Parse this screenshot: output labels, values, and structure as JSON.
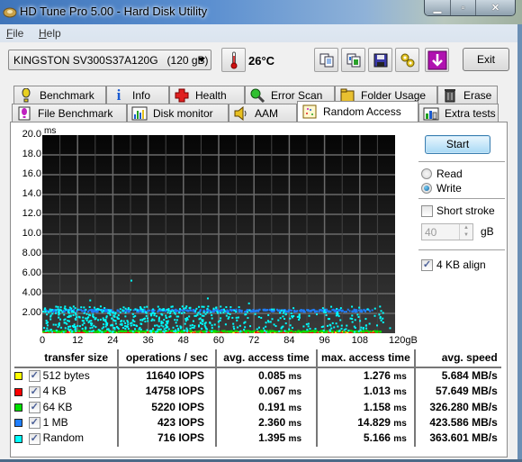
{
  "window": {
    "title": "HD Tune Pro 5.00 - Hard Disk Utility",
    "controls": [
      "minimize",
      "maximize",
      "close"
    ]
  },
  "menu": [
    {
      "label": "File",
      "accel": "F"
    },
    {
      "label": "Help",
      "accel": "H"
    }
  ],
  "toolbar": {
    "drive": "KINGSTON SV300S37A120G   (120 gB)",
    "temperature": "26°C",
    "buttons": [
      "copy-text-icon",
      "copy-screenshot-icon",
      "save-icon",
      "options-icon",
      "download-icon"
    ],
    "exit_label": "Exit"
  },
  "tabs": {
    "row1": [
      {
        "label": "Benchmark",
        "icon": "exclamation-icon"
      },
      {
        "label": "Info",
        "icon": "info-icon"
      },
      {
        "label": "Health",
        "icon": "health-cross-icon"
      },
      {
        "label": "Error Scan",
        "icon": "magnifier-icon"
      },
      {
        "label": "Folder Usage",
        "icon": "folder-icon"
      },
      {
        "label": "Erase",
        "icon": "trash-icon"
      }
    ],
    "row2": [
      {
        "label": "File Benchmark",
        "icon": "file-benchmark-icon"
      },
      {
        "label": "Disk monitor",
        "icon": "disk-monitor-icon"
      },
      {
        "label": "AAM",
        "icon": "speaker-icon"
      },
      {
        "label": "Random Access",
        "icon": "random-access-icon",
        "active": true
      },
      {
        "label": "Extra tests",
        "icon": "extra-tests-icon"
      }
    ]
  },
  "chart_data": {
    "type": "scatter",
    "title": "",
    "ylabel": "ms",
    "xlabel": "gB",
    "ylim": [
      0,
      20
    ],
    "xlim": [
      0,
      120
    ],
    "yticks": [
      "20.0",
      "18.0",
      "16.0",
      "14.0",
      "12.0",
      "10.0",
      "8.00",
      "6.00",
      "4.00",
      "2.00"
    ],
    "xticks": [
      "0",
      "12",
      "24",
      "36",
      "48",
      "60",
      "72",
      "84",
      "96",
      "108",
      "120gB"
    ],
    "grid": true,
    "background": "#000000",
    "series": [
      {
        "name": "512 bytes",
        "color": "#ffff00",
        "typical_ms": 0.085,
        "max_ms": 1.276
      },
      {
        "name": "4 KB",
        "color": "#ff0000",
        "typical_ms": 0.067,
        "max_ms": 1.013
      },
      {
        "name": "64 KB",
        "color": "#00e000",
        "typical_ms": 0.191,
        "max_ms": 1.158
      },
      {
        "name": "1 MB",
        "color": "#1f7fff",
        "typical_ms": 2.36,
        "max_ms": 14.829
      },
      {
        "name": "Random",
        "color": "#00ffff",
        "typical_ms": 1.395,
        "max_ms": 5.166
      }
    ]
  },
  "side": {
    "start_label": "Start",
    "read_label": "Read",
    "write_label": "Write",
    "mode": "Write",
    "short_stroke_label": "Short stroke",
    "short_stroke_checked": false,
    "short_stroke_value": "40",
    "short_stroke_unit": "gB",
    "align_label": "4 KB align",
    "align_checked": true
  },
  "results": {
    "headers": [
      "transfer size",
      "operations / sec",
      "avg. access time",
      "max. access time",
      "avg. speed"
    ],
    "rows": [
      {
        "color": "#ffff00",
        "size": "512 bytes",
        "checked": true,
        "ops": "11640 IOPS",
        "avg": "0.085",
        "max": "1.276",
        "speed": "5.684 MB/s"
      },
      {
        "color": "#ff0000",
        "size": "4 KB",
        "checked": true,
        "ops": "14758 IOPS",
        "avg": "0.067",
        "max": "1.013",
        "speed": "57.649 MB/s"
      },
      {
        "color": "#00e000",
        "size": "64 KB",
        "checked": true,
        "ops": "5220 IOPS",
        "avg": "0.191",
        "max": "1.158",
        "speed": "326.280 MB/s"
      },
      {
        "color": "#1f7fff",
        "size": "1 MB",
        "checked": true,
        "ops": "423 IOPS",
        "avg": "2.360",
        "max": "14.829",
        "speed": "423.586 MB/s"
      },
      {
        "color": "#00ffff",
        "size": "Random",
        "checked": true,
        "ops": "716 IOPS",
        "avg": "1.395",
        "max": "5.166",
        "speed": "363.601 MB/s"
      }
    ],
    "time_unit": "ms"
  }
}
